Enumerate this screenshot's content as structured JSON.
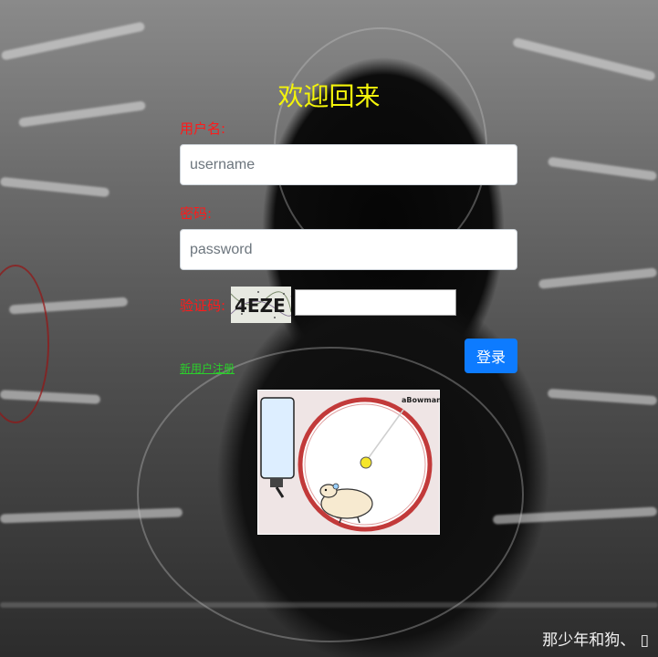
{
  "page": {
    "title": "欢迎回来",
    "accent_label_color": "#ff1a1a",
    "title_color": "#f4f40a",
    "button_color": "#0d7bff",
    "link_color": "#2bd02b"
  },
  "form": {
    "username_label": "用户名:",
    "username_placeholder": "username",
    "password_label": "密码:",
    "password_placeholder": "password",
    "captcha_label": "验证码:",
    "captcha_text": "4EZE",
    "captcha_value": "",
    "login_label": "登录",
    "register_label": "新用户注册"
  },
  "illustration": {
    "credit": "aBowman",
    "icon": "hamster-wheel-animation"
  },
  "footer": {
    "text": "那少年和狗、 ▯"
  }
}
